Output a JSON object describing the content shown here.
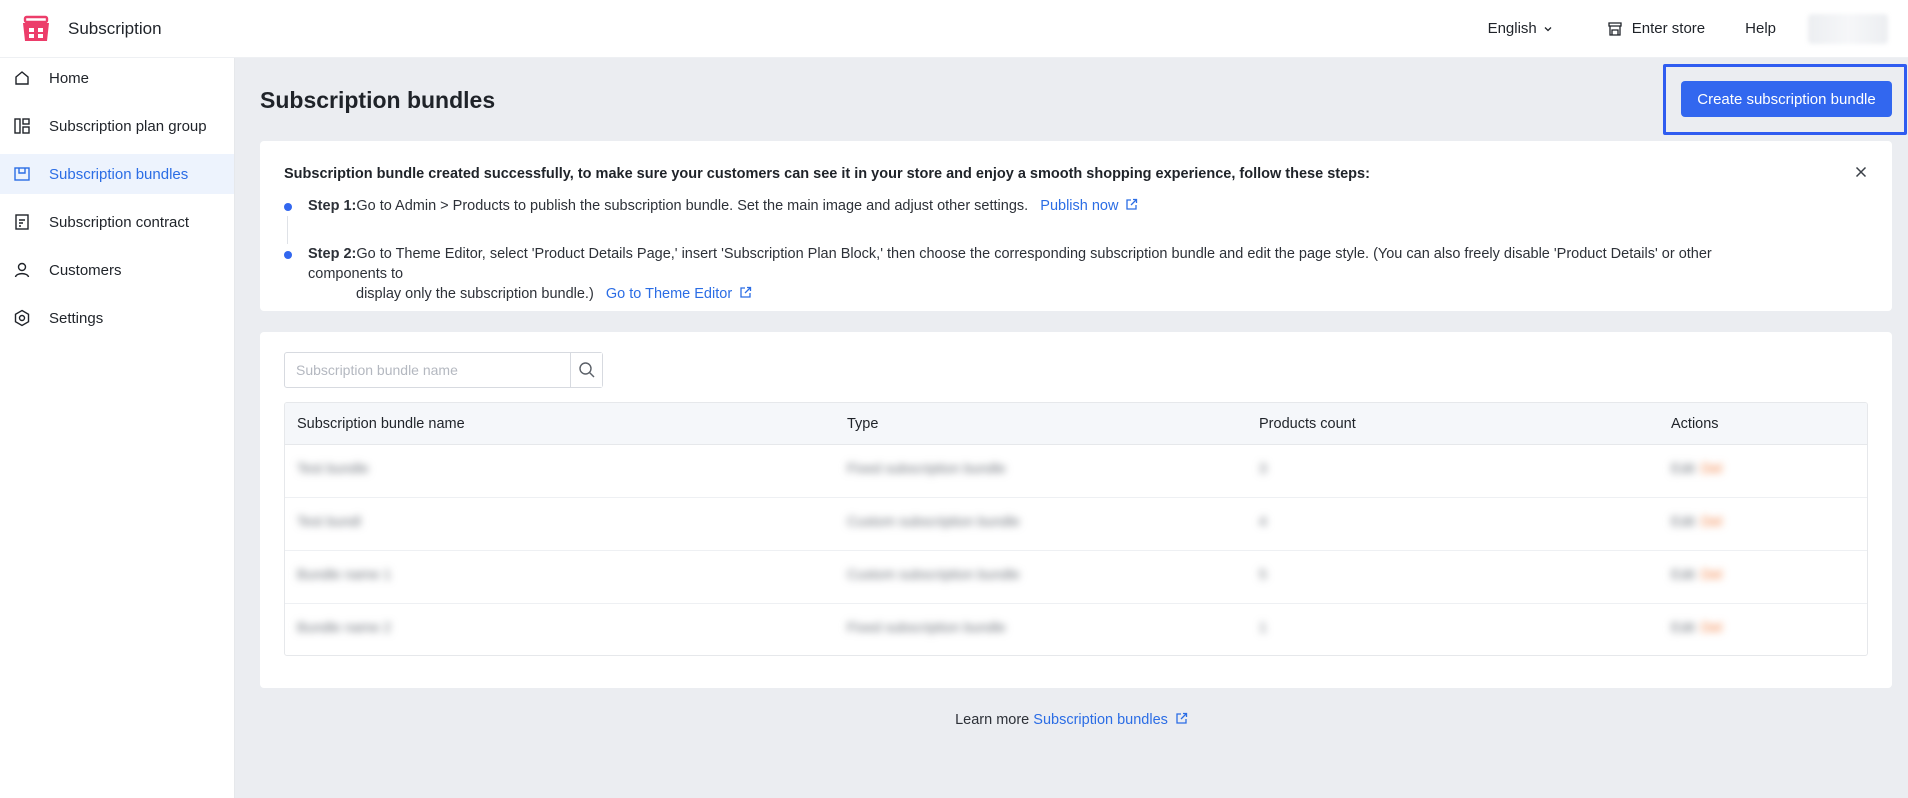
{
  "app": {
    "title": "Subscription",
    "brand_color": "#ec3d6a"
  },
  "topnav": {
    "language": "English",
    "enter_store": "Enter store",
    "help": "Help"
  },
  "sidebar": {
    "items": [
      {
        "label": "Home",
        "icon": "home-icon"
      },
      {
        "label": "Subscription plan group",
        "icon": "plan-group-icon"
      },
      {
        "label": "Subscription bundles",
        "icon": "bundle-icon",
        "active": true
      },
      {
        "label": "Subscription contract",
        "icon": "contract-icon"
      },
      {
        "label": "Customers",
        "icon": "user-icon"
      },
      {
        "label": "Settings",
        "icon": "settings-icon"
      }
    ]
  },
  "page": {
    "title": "Subscription bundles",
    "create_button": "Create subscription bundle",
    "accent_color": "#3267ef"
  },
  "notice": {
    "title": "Subscription bundle created successfully, to make sure your customers can see it in your store and enjoy a smooth shopping experience, follow these steps:",
    "step1": {
      "label": "Step 1:",
      "text": "Go to Admin > Products to publish the subscription bundle. Set the main image and adjust other settings.",
      "link": "Publish now"
    },
    "step2": {
      "label": "Step 2:",
      "text_line1": "Go to Theme Editor, select 'Product Details Page,' insert 'Subscription Plan Block,' then choose the corresponding subscription bundle and edit the page style. (You can also freely disable 'Product Details' or other components to",
      "text_line2": "display only the subscription bundle.)",
      "link": "Go to Theme Editor"
    }
  },
  "search": {
    "placeholder": "Subscription bundle name"
  },
  "table": {
    "columns": [
      "Subscription bundle name",
      "Type",
      "Products count",
      "Actions"
    ],
    "rows": [
      {
        "name": "Test bundle",
        "type": "Fixed subscription bundle",
        "count": "3",
        "action_a": "Edit",
        "action_b": "Del"
      },
      {
        "name": "Test bundl",
        "type": "Custom subscription bundle",
        "count": "4",
        "action_a": "Edit",
        "action_b": "Del"
      },
      {
        "name": "Bundle name 1",
        "type": "Custom subscription bundle",
        "count": "5",
        "action_a": "Edit",
        "action_b": "Del"
      },
      {
        "name": "Bundle name 2",
        "type": "Fixed subscription bundle",
        "count": "1",
        "action_a": "Edit",
        "action_b": "Del"
      }
    ]
  },
  "footer": {
    "text": "Learn more",
    "link": "Subscription bundles"
  }
}
